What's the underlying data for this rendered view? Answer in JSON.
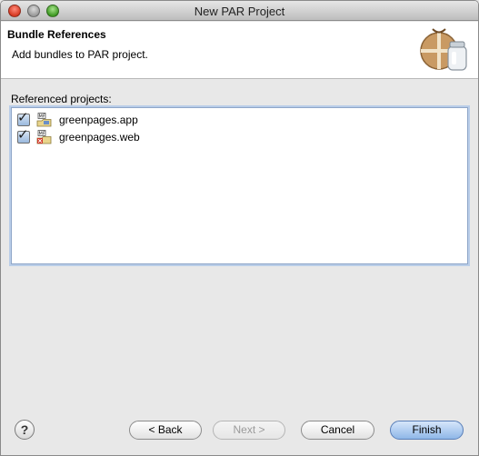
{
  "window": {
    "title": "New PAR Project"
  },
  "banner": {
    "title": "Bundle References",
    "message": "Add bundles to PAR project.",
    "icon": "bundle-jar-icon"
  },
  "references": {
    "label": "Referenced projects:",
    "items": [
      {
        "label": "greenpages.app",
        "checked": true,
        "icon": "manifest-project-icon"
      },
      {
        "label": "greenpages.web",
        "checked": true,
        "icon": "manifest-project-error-icon"
      }
    ]
  },
  "buttons": {
    "back": "< Back",
    "next": "Next >",
    "cancel": "Cancel",
    "finish": "Finish",
    "help": "?"
  },
  "colors": {
    "accent": "#8fb7e8",
    "error": "#d03a2a"
  }
}
